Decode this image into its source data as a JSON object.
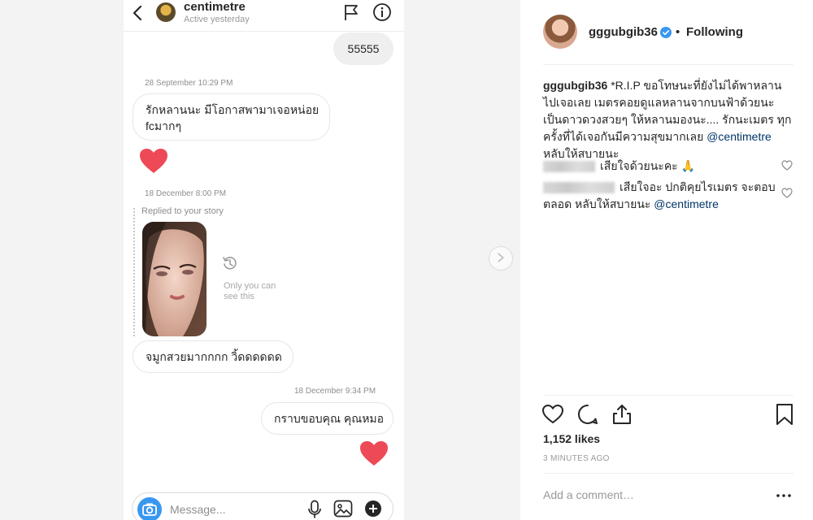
{
  "dm": {
    "username": "centimetre",
    "status": "Active yesterday",
    "messages": {
      "m1": "55555",
      "ts1": "28 September 10:29 PM",
      "m2_line1": "รักหลานนะ มีโอกาสพามาเจอหน่อย",
      "m2_line2": "fcมากๆ",
      "ts2": "18 December 8:00 PM",
      "story_label": "Replied to your story",
      "only_you": "Only you can\nsee this",
      "m3": "จมูกสวยมากกกก วิ้ดดดดดด",
      "ts3": "18 December 9:34 PM",
      "m4": "กราบขอบคุณ คุณหมอ"
    },
    "composer_placeholder": "Message..."
  },
  "post": {
    "username": "gggubgib36",
    "separator": "•",
    "follow_state": "Following",
    "caption_user": "gggubgib36",
    "caption_text": "*R.I.P ขอโทษนะที่ยังไม่ได้พาหลานไปเจอเลย เมตรคอยดูแลหลานจากบนฟ้าด้วยนะ เป็นดาวดวงสวยๆ ให้หลานมองนะ.... รักนะเมตร ทุกครั้งที่ได้เจอกันมีความสุขมากเลย",
    "caption_mention": "@centimetre",
    "caption_tail": "หลับให้สบายนะ",
    "comments": [
      {
        "text": "เสียใจด้วยนะคะ 🙏"
      },
      {
        "text": "เสียใจอะ ปกติคุยไรเมตร จะตอบตลอด หลับให้สบายนะ",
        "mention": "@centimetre"
      }
    ],
    "likes": "1,152 likes",
    "time_ago": "3 MINUTES AGO",
    "add_comment_placeholder": "Add a comment…"
  },
  "colors": {
    "heart": "#ed4956",
    "link": "#003569",
    "verified": "#3897f0",
    "camera": "#3897f0"
  },
  "icons": [
    "back-icon",
    "flag-icon",
    "info-icon",
    "history-icon",
    "camera-icon",
    "mic-icon",
    "gallery-icon",
    "plus-icon",
    "chevron-right-icon",
    "verified-icon",
    "heart-icon",
    "comment-icon",
    "share-icon",
    "bookmark-icon",
    "more-icon"
  ]
}
